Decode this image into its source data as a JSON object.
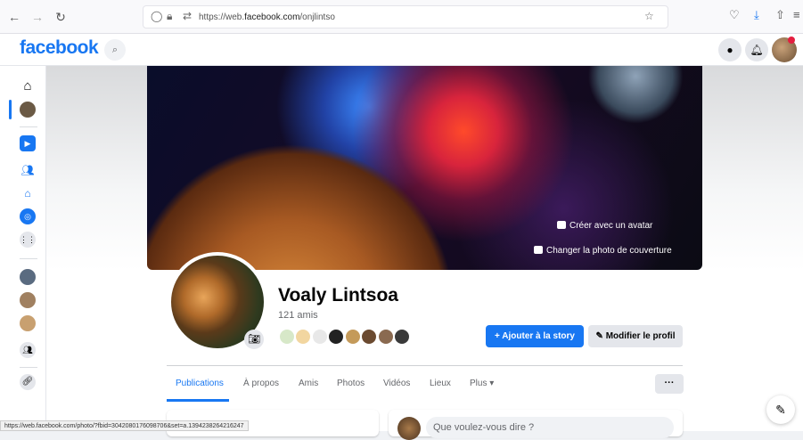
{
  "browser": {
    "url_prefix": "https://web.",
    "url_domain": "facebook.com",
    "url_path": "/onjlintso"
  },
  "header": {
    "logo": "facebook"
  },
  "cover": {
    "avatar_label": "Créer avec un avatar",
    "change_cover_label": "Changer la photo de couverture"
  },
  "profile": {
    "name": "Voaly Lintsoa",
    "friends": "121 amis",
    "add_story_label": "+ Ajouter à la story",
    "edit_profile_label": "Modifier le profil"
  },
  "tabs": [
    {
      "label": "Publications",
      "active": true
    },
    {
      "label": "À propos"
    },
    {
      "label": "Amis"
    },
    {
      "label": "Photos"
    },
    {
      "label": "Vidéos"
    },
    {
      "label": "Lieux"
    },
    {
      "label": "Plus ▾"
    }
  ],
  "more_button": "···",
  "composer": {
    "placeholder": "Que voulez-vous dire ?"
  },
  "status_bar": {
    "url": "https://web.facebook.com/photo/?fbid=3042080176098706&set=a.1394238264216247"
  },
  "colors": {
    "brand": "#1877f2",
    "notification": "#e41e3f"
  }
}
